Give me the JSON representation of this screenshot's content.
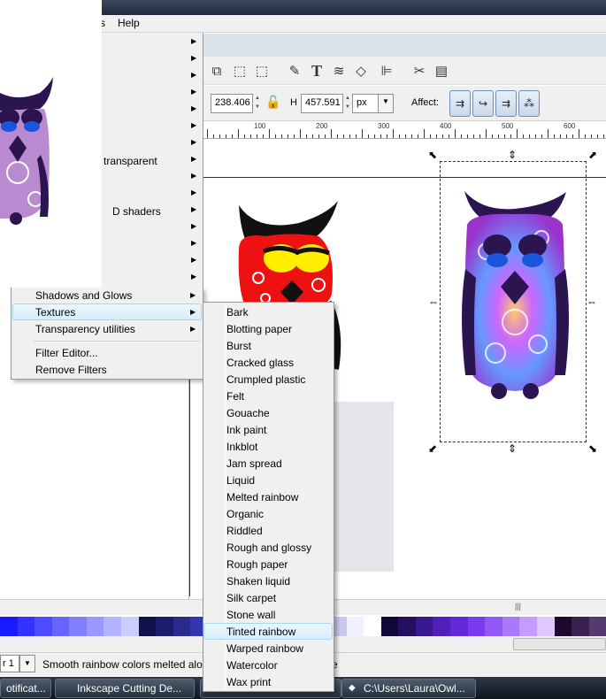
{
  "menubar": {
    "help": "Help",
    "partial": "s"
  },
  "toolbar": {
    "y_value": "238.406",
    "h_label": "H",
    "h_value": "457.591",
    "unit": "px",
    "affect_label": "Affect:"
  },
  "ruler": {
    "labels": [
      "100",
      "200",
      "300",
      "400",
      "500",
      "600"
    ]
  },
  "filters_menu": {
    "partial_items": [
      "transparent",
      "D shaders"
    ],
    "items": [
      "Shadows and Glows",
      "Textures",
      "Transparency utilities"
    ],
    "footer_items": [
      "Filter Editor...",
      "Remove Filters"
    ]
  },
  "textures_menu": {
    "items": [
      "Bark",
      "Blotting paper",
      "Burst",
      "Cracked glass",
      "Crumpled plastic",
      "Felt",
      "Gouache",
      "Ink paint",
      "Inkblot",
      "Jam spread",
      "Liquid",
      "Melted rainbow",
      "Organic",
      "Riddled",
      "Rough and glossy",
      "Rough paper",
      "Shaken liquid",
      "Silk carpet",
      "Stone wall",
      "Tinted rainbow",
      "Warped rainbow",
      "Watercolor",
      "Wax print"
    ],
    "selected": "Tinted rainbow"
  },
  "statusbar": {
    "layer": "r 1",
    "text": "Smooth rainbow colors melted alo",
    "text_tail": "e"
  },
  "taskbar": {
    "items": [
      "otificat...",
      "Inkscape Cutting De...",
      "C:\\Users\\Laura\\Owl..."
    ]
  },
  "palette_colors": [
    "#1a1aff",
    "#3333ff",
    "#4d4dff",
    "#6666ff",
    "#8080ff",
    "#9999ff",
    "#b3b3ff",
    "#ccccff",
    "#10104a",
    "#1c1c6e",
    "#2a2a8f",
    "#3535b0",
    "#4545cc",
    "#5a5ae0",
    "#7070ee",
    "#9090f5",
    "#b0b0fa",
    "#d0d0ff",
    "#e0e0ff",
    "#c8c8e8",
    "#f0f0ff",
    "#ffffff",
    "#120838",
    "#240f60",
    "#3a1890",
    "#4e20b8",
    "#6428d8",
    "#7a3aee",
    "#9258f5",
    "#aa78fa",
    "#c49cfd",
    "#e0c8ff",
    "#1a0a2e",
    "#3a2250",
    "#553a70"
  ],
  "colors": {
    "owl_red": "#ee1111",
    "owl_yellow": "#ffee00",
    "owl_purple": "#2a1550",
    "selection_blue": "#d7effc"
  }
}
